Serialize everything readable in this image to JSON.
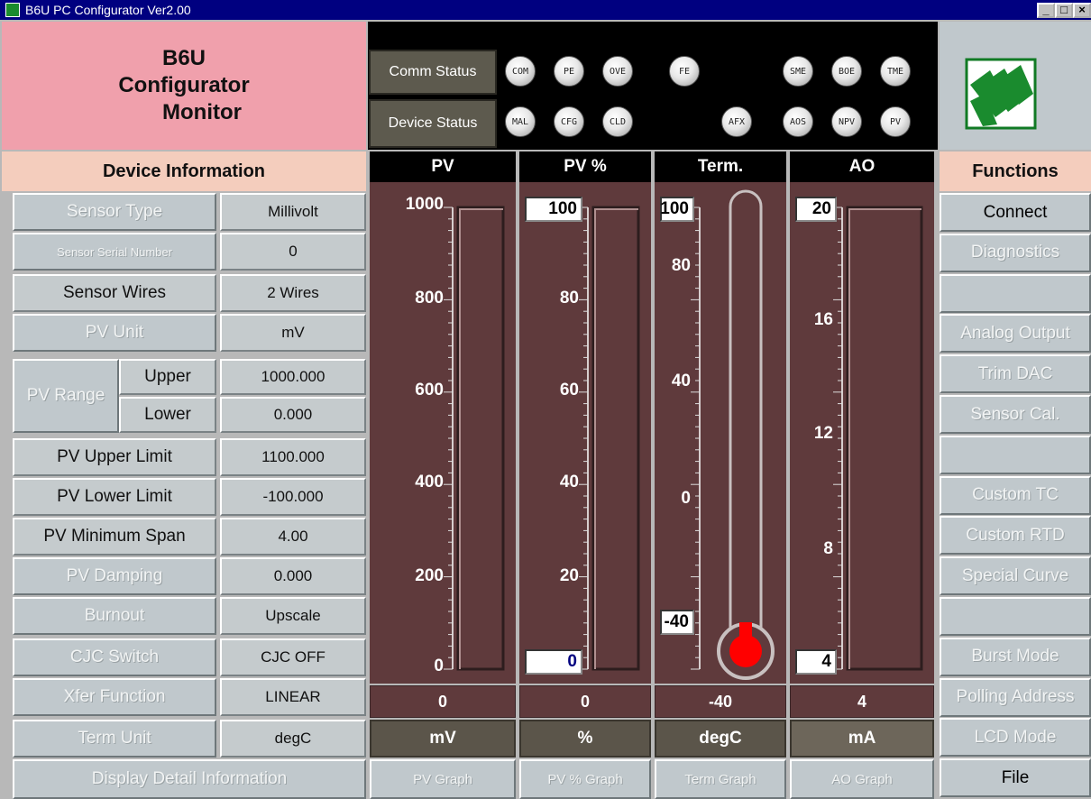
{
  "window": {
    "title": "B6U PC Configurator Ver2.00"
  },
  "app": {
    "line1": "B6U",
    "line2": "Configurator",
    "line3": "Monitor"
  },
  "status": {
    "comm_label": "Comm Status",
    "device_label": "Device Status",
    "comm_leds": [
      "COM",
      "PE",
      "OVE",
      "FE",
      "SME",
      "BOE",
      "TME"
    ],
    "device_leds": [
      "MAL",
      "CFG",
      "CLD",
      "AFX",
      "AOS",
      "NPV",
      "PV"
    ]
  },
  "device_info": {
    "header": "Device Information",
    "rows": [
      {
        "label": "Sensor Type",
        "value": "Millivolt"
      },
      {
        "label": "Sensor Serial Number",
        "value": "0"
      },
      {
        "label": "Sensor Wires",
        "value": "2 Wires"
      },
      {
        "label": "PV Unit",
        "value": "mV"
      },
      {
        "label": "PV Upper Limit",
        "value": "1100.000"
      },
      {
        "label": "PV Lower Limit",
        "value": "-100.000"
      },
      {
        "label": "PV Minimum Span",
        "value": "4.00"
      },
      {
        "label": "PV Damping",
        "value": "0.000"
      },
      {
        "label": "Burnout",
        "value": "Upscale"
      },
      {
        "label": "CJC Switch",
        "value": "CJC OFF"
      },
      {
        "label": "Xfer Function",
        "value": "LINEAR"
      },
      {
        "label": "Term Unit",
        "value": "degC"
      }
    ],
    "pv_range": {
      "label": "PV Range",
      "upper_label": "Upper",
      "upper_value": "1000.000",
      "lower_label": "Lower",
      "lower_value": "0.000"
    },
    "detail_button": "Display Detail Information"
  },
  "gauges": [
    {
      "title": "PV",
      "ticks": [
        "1000",
        "800",
        "600",
        "400",
        "200",
        "0"
      ],
      "readout": "0",
      "unit": "mV",
      "graph_button": "PV Graph",
      "fill_fraction": 0
    },
    {
      "title": "PV %",
      "ticks": [
        "80",
        "60",
        "40",
        "20"
      ],
      "max_input": "100",
      "min_input": "0",
      "readout": "0",
      "unit": "%",
      "graph_button": "PV % Graph",
      "fill_fraction": 0
    },
    {
      "title": "Term.",
      "ticks": [
        "80",
        "40",
        "0"
      ],
      "max_input": "100",
      "min_input": "-40",
      "readout": "-40",
      "unit": "degC",
      "graph_button": "Term Graph",
      "fill_fraction": 0
    },
    {
      "title": "AO",
      "ticks": [
        "16",
        "12",
        "8"
      ],
      "max_input": "20",
      "min_input": "4",
      "readout": "4",
      "unit": "mA",
      "graph_button": "AO Graph",
      "fill_fraction": 0
    }
  ],
  "functions": {
    "header": "Functions",
    "items": [
      "Connect",
      "Diagnostics",
      "",
      "Analog Output",
      "Trim DAC",
      "Sensor Cal.",
      "",
      "Custom TC",
      "Custom RTD",
      "Special Curve",
      "",
      "Burst Mode",
      "Polling Address",
      "LCD Mode",
      "File"
    ],
    "enabled": [
      true,
      false,
      false,
      false,
      false,
      false,
      false,
      false,
      false,
      false,
      false,
      false,
      false,
      false,
      true
    ]
  },
  "colors": {
    "accent_pink": "#f0a0ac",
    "panel": "#5f3a3c",
    "logo_green": "#1a8b2e",
    "thermo_red": "#ff0000"
  }
}
